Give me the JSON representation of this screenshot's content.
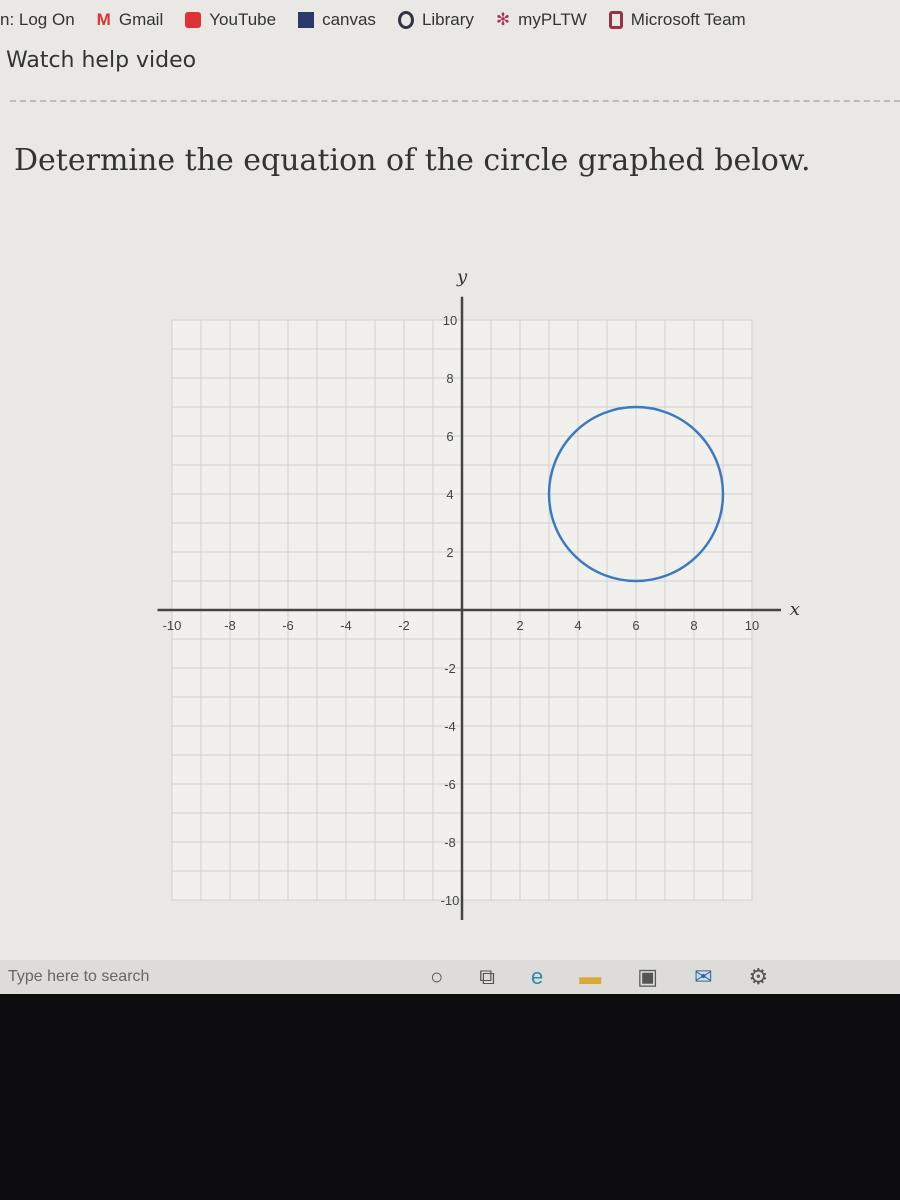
{
  "bookmarks": [
    "n: Log On",
    "Gmail",
    "YouTube",
    "canvas",
    "Library",
    "myPLTW",
    "Microsoft Team"
  ],
  "help_link": "Watch help video",
  "question": "Determine the equation of the circle graphed below.",
  "chart_data": {
    "type": "scatter",
    "title": "",
    "xlabel": "x",
    "ylabel": "y",
    "xlim": [
      -10,
      10
    ],
    "ylim": [
      -10,
      10
    ],
    "grid": true,
    "x_ticks": [
      "-10",
      "-8",
      "-6",
      "-4",
      "-2",
      "2",
      "4",
      "6",
      "8",
      "10"
    ],
    "y_ticks": [
      "10",
      "8",
      "6",
      "4",
      "2",
      "-2",
      "-4",
      "-6",
      "-8",
      "-10"
    ],
    "circle": {
      "center": [
        6,
        4
      ],
      "radius": 3,
      "color": "#3a7ac0"
    }
  },
  "taskbar": {
    "search_placeholder": "Type here to search",
    "icons": [
      "cortana-icon",
      "task-view-icon",
      "edge-icon",
      "file-explorer-icon",
      "store-icon",
      "mail-icon",
      "settings-icon"
    ]
  }
}
